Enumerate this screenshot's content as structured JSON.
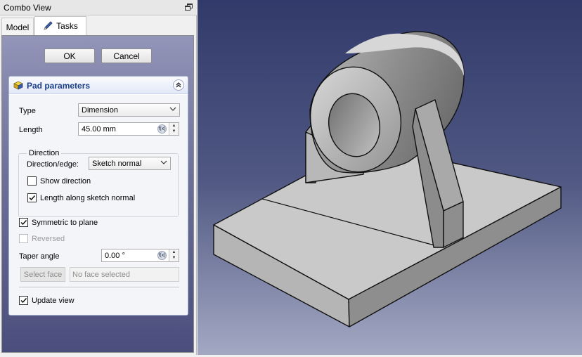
{
  "combo_view": {
    "title": "Combo View",
    "tabs": [
      {
        "label": "Model",
        "active": false
      },
      {
        "label": "Tasks",
        "active": true
      }
    ]
  },
  "actions": {
    "ok_label": "OK",
    "cancel_label": "Cancel"
  },
  "pad": {
    "title": "Pad parameters",
    "type_label": "Type",
    "type_value": "Dimension",
    "length_label": "Length",
    "length_value": "45.00 mm",
    "direction": {
      "group_title": "Direction",
      "edge_label": "Direction/edge:",
      "edge_value": "Sketch normal",
      "show_direction_label": "Show direction",
      "show_direction_checked": false,
      "along_normal_label": "Length along sketch normal",
      "along_normal_checked": true
    },
    "symmetric_label": "Symmetric to plane",
    "symmetric_checked": true,
    "reversed_label": "Reversed",
    "reversed_checked": false,
    "taper_label": "Taper angle",
    "taper_value": "0.00 °",
    "select_face_label": "Select face",
    "face_value": "No face selected",
    "update_view_label": "Update view",
    "update_view_checked": true
  },
  "colors": {
    "accent_title": "#1a3d8a",
    "viewport_top": "#323a6b",
    "viewport_bottom": "#a3a9c3",
    "model_face_light": "#c9c9c9",
    "model_face_dark": "#8e8e8e"
  },
  "icons": {
    "float": "float-window-icon",
    "tasks": "pencil-icon",
    "pad": "pad-feature-icon",
    "collapse": "collapse-chevron-icon",
    "expression": "fx-expression-icon"
  }
}
